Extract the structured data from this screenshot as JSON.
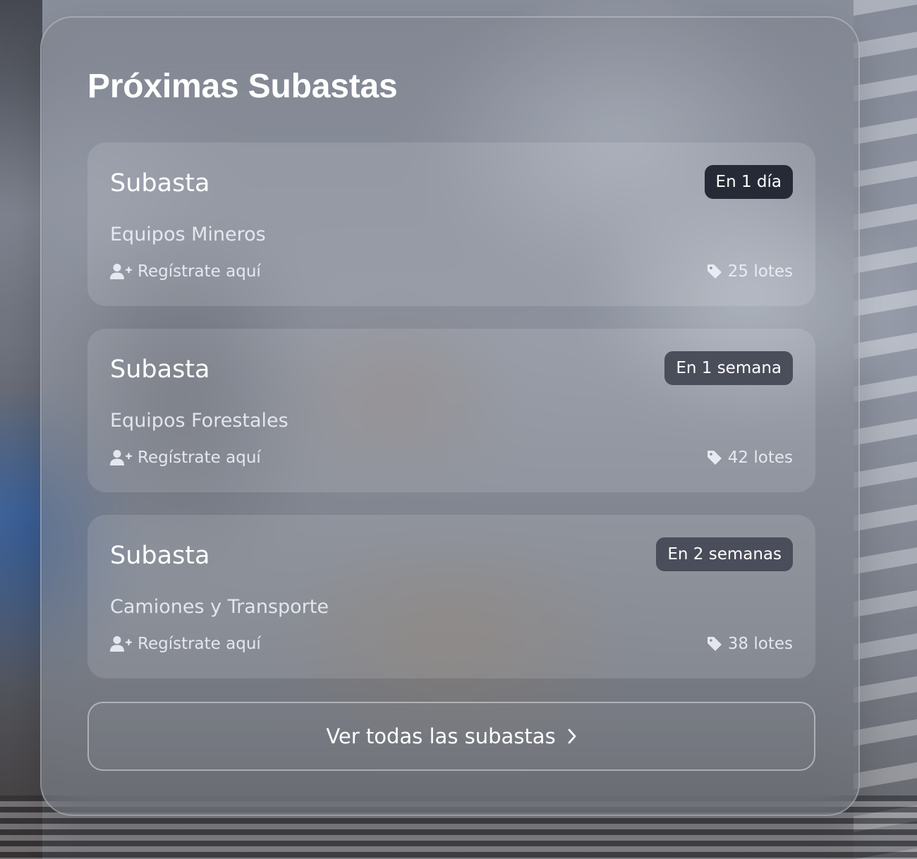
{
  "panel": {
    "title": "Próximas Subastas"
  },
  "auctions": [
    {
      "title": "Subasta",
      "category": "Equipos Mineros",
      "badge": "En 1 día",
      "badge_color": "#252a36",
      "register_label": "Regístrate aquí",
      "register_icon": "user-plus-icon",
      "lots": "25 lotes",
      "lots_icon": "tag-icon"
    },
    {
      "title": "Subasta",
      "category": "Equipos Forestales",
      "badge": "En 1 semana",
      "badge_color": "#4a4d5a",
      "register_label": "Regístrate aquí",
      "register_icon": "user-plus-icon",
      "lots": "42 lotes",
      "lots_icon": "tag-icon"
    },
    {
      "title": "Subasta",
      "category": "Camiones y Transporte",
      "badge": "En 2 semanas",
      "badge_color": "#4a4d5a",
      "register_label": "Regístrate aquí",
      "register_icon": "user-plus-icon",
      "lots": "38 lotes",
      "lots_icon": "tag-icon"
    }
  ],
  "footer": {
    "view_all_label": "Ver todas las subastas",
    "view_all_icon": "chevron-right-icon"
  }
}
